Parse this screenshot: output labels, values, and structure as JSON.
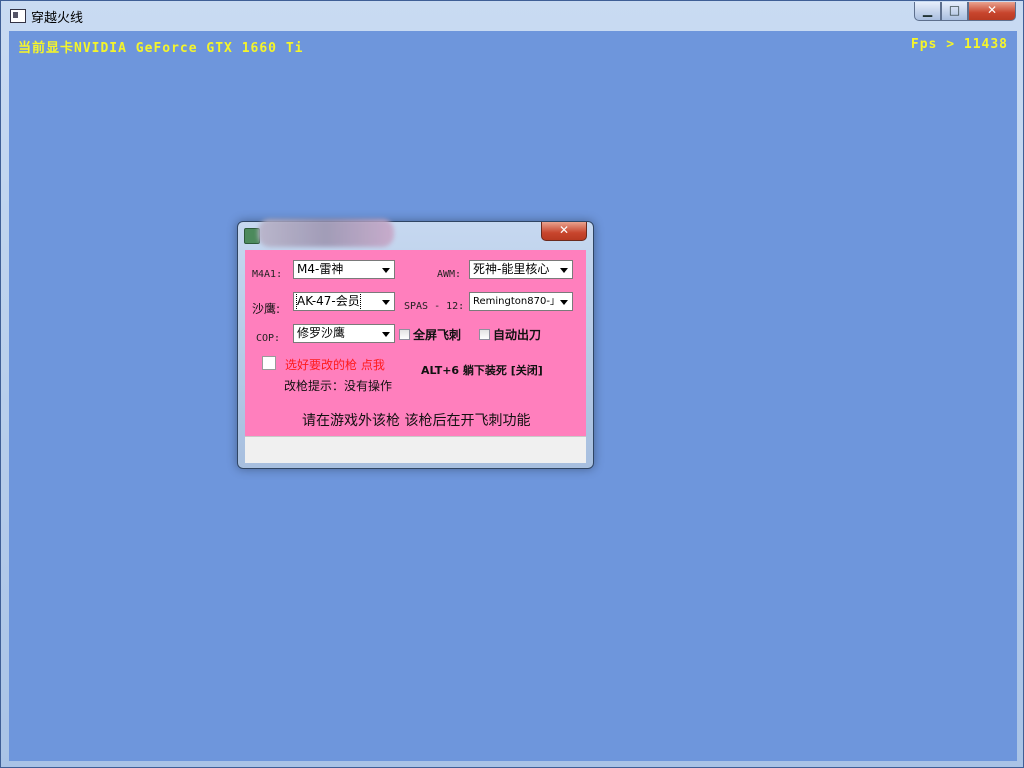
{
  "window": {
    "title": "穿越火线",
    "controls": {
      "minimize": "▁",
      "maximize": "□",
      "close": "✕"
    }
  },
  "overlay": {
    "gpu_text": "当前显卡NVIDIA GeForce GTX 1660 Ti",
    "fps_text": "Fps > 11438",
    "color": "#f5f52a"
  },
  "dialog": {
    "close": "✕",
    "m4a1": {
      "label": "M4A1:",
      "value": "M4-雷神"
    },
    "awm": {
      "label": "AWM:",
      "value": "死神-能里核心"
    },
    "deagle": {
      "label": "沙鹰:",
      "value": "AK-47-会员"
    },
    "spas": {
      "label": "SPAS - 12:",
      "value": "Remington870-」"
    },
    "cop": {
      "label": "COP:",
      "value": "修罗沙鹰"
    },
    "fullscreen_knife": "全屏飞刺",
    "auto_knife": "自动出刀",
    "pick_gun": "选好要改的枪 点我",
    "hint": "改枪提示：没有操作",
    "hotkey": "ALT+6 躺下装死 [关闭]",
    "notice": "请在游戏外该枪 该枪后在开飞刺功能"
  },
  "colors": {
    "game_bg": "#6e96dc",
    "dialog_bg": "#ff7fbd",
    "title_close": "#c8452d"
  },
  "icons": [
    "app-icon",
    "dropdown-arrow-icon",
    "checkbox-icon"
  ]
}
